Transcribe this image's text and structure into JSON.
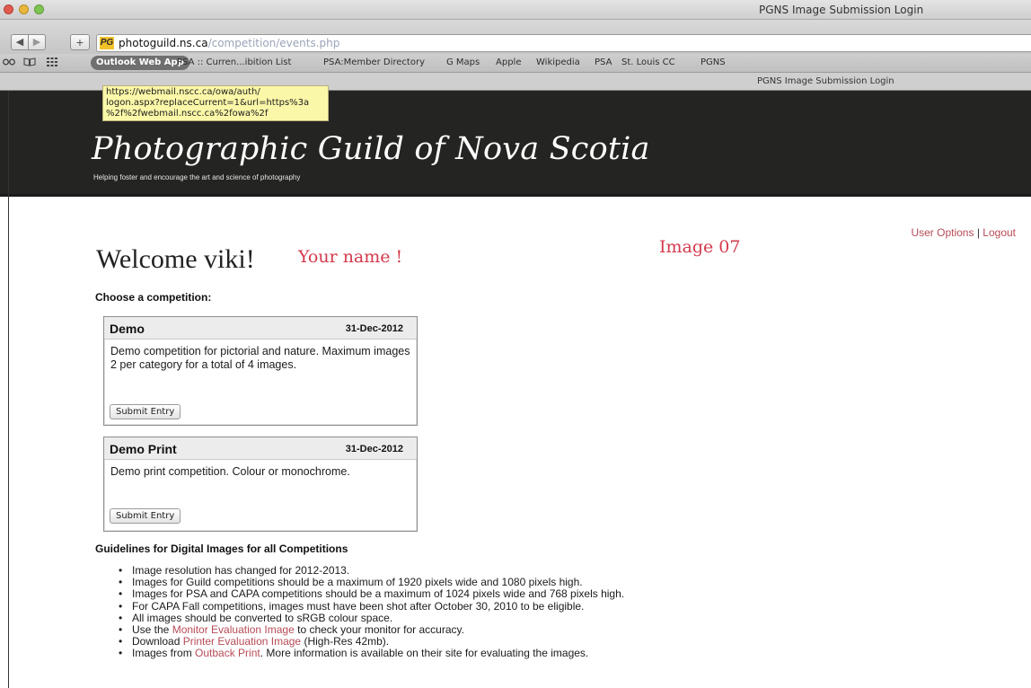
{
  "window": {
    "title": "PGNS Image Submission Login"
  },
  "toolbar": {
    "back_icon": "◀",
    "forward_icon": "▶",
    "add_icon": "+",
    "favicon_text": "PG",
    "url_host": "photoguild.ns.ca",
    "url_path": "/competition/events.php"
  },
  "bookmarks": {
    "icons": [
      "reading-glasses-icon",
      "book-icon",
      "grid-icon"
    ],
    "active": "Outlook Web App",
    "items": [
      "PSA :: Curren...ibition List",
      "PSA:Member Directory",
      "G Maps",
      "Apple",
      "Wikipedia",
      "PSA",
      "St. Louis CC",
      "PGNS"
    ]
  },
  "tab": {
    "title": "PGNS Image Submission Login"
  },
  "tooltip": {
    "text": "https://webmail.nscc.ca/owa/auth/\nlogon.aspx?replaceCurrent=1&url=https%3a\n%2f%2fwebmail.nscc.ca%2fowa%2f"
  },
  "site": {
    "title": "Photographic Guild of Nova Scotia",
    "tagline": "Helping foster and encourage the art and science of photography"
  },
  "user_options": {
    "options_label": "User Options",
    "separator": "|",
    "logout_label": "Logout"
  },
  "welcome": {
    "text": "Welcome viki!"
  },
  "annotations": {
    "name_note": "Your name !",
    "image_note": "Image 07"
  },
  "choose_label": "Choose a competition:",
  "competitions": [
    {
      "name": "Demo",
      "date": "31-Dec-2012",
      "description": "Demo competition for pictorial and nature. Maximum images 2 per category for a total of 4 images.",
      "button": "Submit Entry"
    },
    {
      "name": "Demo Print",
      "date": "31-Dec-2012",
      "description": "Demo print competition. Colour or monochrome.",
      "button": "Submit Entry"
    }
  ],
  "guidelines": {
    "title": "Guidelines for Digital Images for all Competitions",
    "items": [
      "Image resolution has changed for 2012-2013.",
      "Images for Guild competitions should be a maximum of 1920 pixels wide and 1080 pixels high.",
      "Images for PSA and CAPA competitions should be a maximum of 1024 pixels wide and 768 pixels high.",
      "For CAPA Fall competitions, images must have been shot after October 30, 2010 to be eligible.",
      "All images should be converted to sRGB colour space."
    ],
    "monitor": {
      "before": "Use the ",
      "link": "Monitor Evaluation Image",
      "after": " to check your monitor for accuracy."
    },
    "printer": {
      "before": "Download ",
      "link": "Printer Evaluation Image",
      "after": " (High-Res 42mb)."
    },
    "outback": {
      "before": "Images from ",
      "link": "Outback Print",
      "after": ". More information is available on their site for evaluating the images."
    }
  },
  "colors": {
    "banner": "#242423",
    "link": "#b64b56",
    "annotation": "#d33a4d",
    "tooltip_bg": "#fbf7a8"
  }
}
